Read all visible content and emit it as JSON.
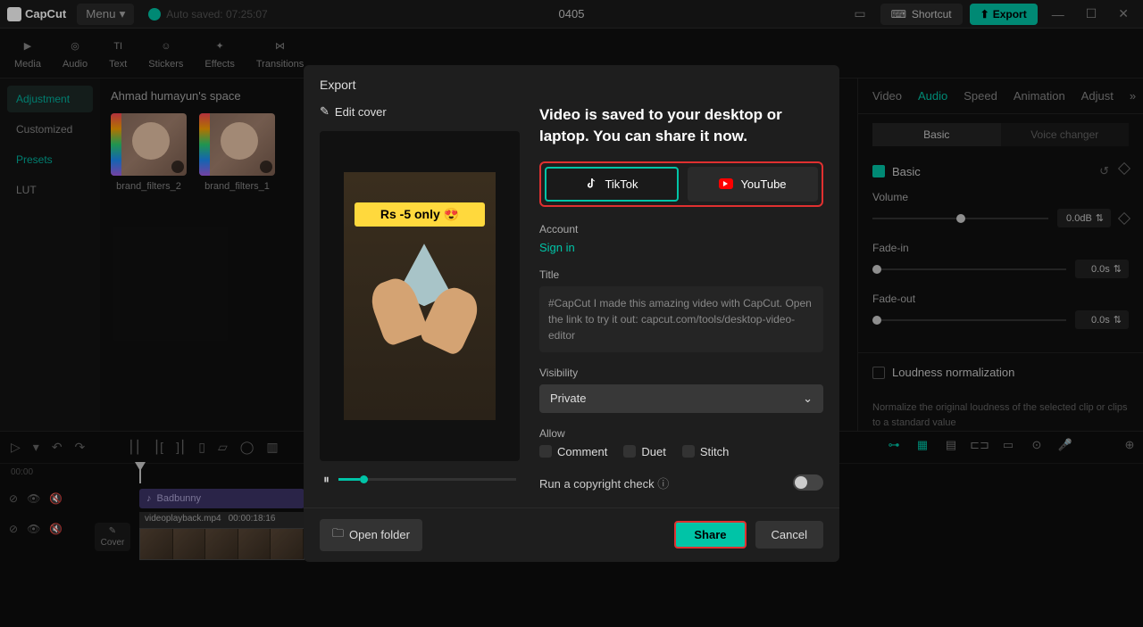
{
  "app": {
    "name": "CapCut",
    "menu": "Menu",
    "autosave": "Auto saved: 07:25:07",
    "project_title": "0405",
    "shortcut": "Shortcut",
    "export": "Export"
  },
  "tool_tabs": [
    "Media",
    "Audio",
    "Text",
    "Stickers",
    "Effects",
    "Transitions"
  ],
  "sidebar": {
    "items": [
      "Adjustment",
      "Customized",
      "Presets",
      "LUT"
    ],
    "active": 0
  },
  "breadcrumb": "Ahmad humayun's space",
  "thumbs": [
    {
      "label": "brand_filters_2"
    },
    {
      "label": "brand_filters_1"
    }
  ],
  "inspector": {
    "tabs": [
      "Video",
      "Audio",
      "Speed",
      "Animation",
      "Adjust"
    ],
    "active_tab": 1,
    "subtabs": [
      "Basic",
      "Voice changer"
    ],
    "basic_label": "Basic",
    "volume": {
      "label": "Volume",
      "value": "0.0dB"
    },
    "fade_in": {
      "label": "Fade-in",
      "value": "0.0s"
    },
    "fade_out": {
      "label": "Fade-out",
      "value": "0.0s"
    },
    "loudness": {
      "label": "Loudness normalization",
      "desc": "Normalize the original loudness of the selected clip or clips to a standard value"
    }
  },
  "timeline": {
    "ruler_start": "00:00",
    "audio_clip": "Badbunny",
    "video_clip": {
      "name": "videoplayback.mp4",
      "duration": "00:00:18:16"
    },
    "cover": "Cover"
  },
  "modal": {
    "title": "Export",
    "edit_cover": "Edit cover",
    "preview_badge": "Rs -5 only 😍",
    "share_heading": "Video is saved to your desktop or laptop. You can share it now.",
    "tiktok": "TikTok",
    "youtube": "YouTube",
    "account_label": "Account",
    "signin": "Sign in",
    "title_label": "Title",
    "title_text": "#CapCut I made this amazing video with CapCut. Open the link to try it out: capcut.com/tools/desktop-video-editor",
    "visibility_label": "Visibility",
    "visibility_value": "Private",
    "allow_label": "Allow",
    "allow_comment": "Comment",
    "allow_duet": "Duet",
    "allow_stitch": "Stitch",
    "copyright": "Run a copyright check",
    "open_folder": "Open folder",
    "share": "Share",
    "cancel": "Cancel"
  }
}
